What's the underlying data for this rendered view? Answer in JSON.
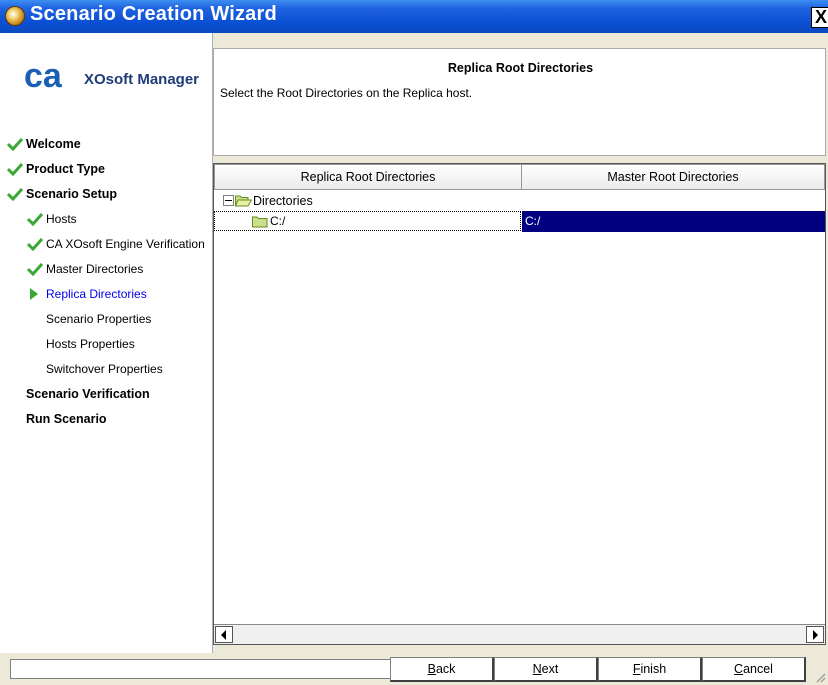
{
  "window": {
    "title": "Scenario Creation Wizard",
    "close_label": "X"
  },
  "brand": {
    "logo_text": "XOsoft Manager"
  },
  "steps": [
    {
      "label": "Welcome",
      "state": "done",
      "level": "main"
    },
    {
      "label": "Product Type",
      "state": "done",
      "level": "main"
    },
    {
      "label": "Scenario Setup",
      "state": "done",
      "level": "main"
    },
    {
      "label": "Hosts",
      "state": "done",
      "level": "sub"
    },
    {
      "label": "CA XOsoft Engine Verification",
      "state": "done",
      "level": "sub"
    },
    {
      "label": "Master Directories",
      "state": "done",
      "level": "sub"
    },
    {
      "label": "Replica Directories",
      "state": "current",
      "level": "sub"
    },
    {
      "label": "Scenario Properties",
      "state": "pending",
      "level": "sub"
    },
    {
      "label": "Hosts Properties",
      "state": "pending",
      "level": "sub"
    },
    {
      "label": "Switchover Properties",
      "state": "pending",
      "level": "sub"
    },
    {
      "label": "Scenario Verification",
      "state": "pending",
      "level": "main"
    },
    {
      "label": "Run Scenario",
      "state": "pending",
      "level": "main"
    }
  ],
  "header": {
    "title": "Replica Root Directories",
    "description": "Select the Root Directories on the Replica host."
  },
  "grid": {
    "columns": [
      "Replica Root Directories",
      "Master Root Directories"
    ],
    "tree_root": "Directories",
    "rows": [
      {
        "replica": "C:/",
        "master": "C:/"
      }
    ]
  },
  "buttons": {
    "back": {
      "pre": "",
      "key": "B",
      "post": "ack"
    },
    "next": {
      "pre": "",
      "key": "N",
      "post": "ext"
    },
    "finish": {
      "pre": "",
      "key": "F",
      "post": "inish"
    },
    "cancel": {
      "pre": "",
      "key": "C",
      "post": "ancel"
    }
  },
  "colors": {
    "title_bar": "#0a4fd3",
    "selection": "#000080",
    "check": "#3aa832",
    "current_step": "#0000ee"
  },
  "status": {
    "text": ""
  }
}
